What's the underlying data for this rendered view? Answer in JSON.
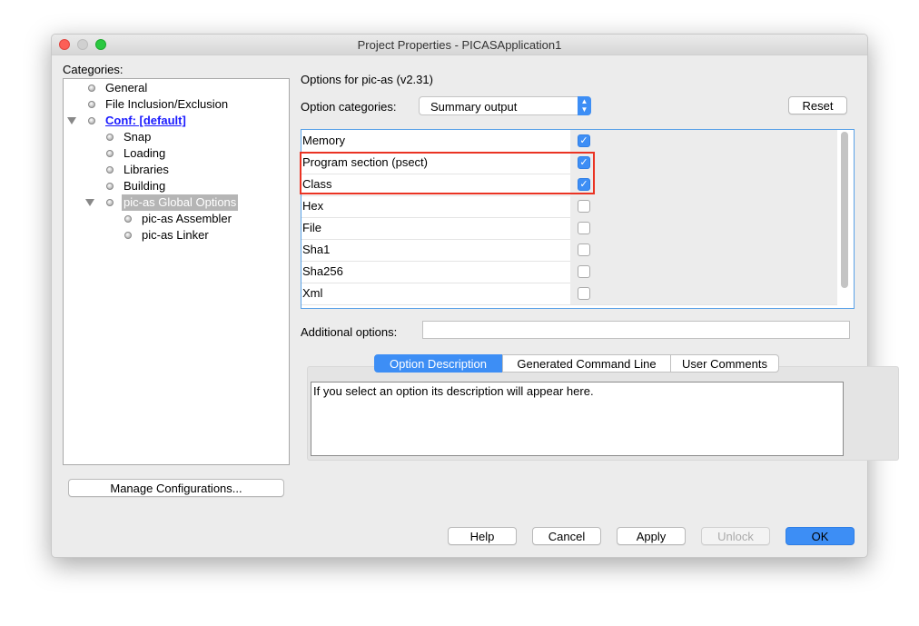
{
  "window": {
    "title": "Project Properties - PICASApplication1"
  },
  "categories": {
    "label": "Categories:",
    "items": [
      {
        "label": "General"
      },
      {
        "label": "File Inclusion/Exclusion"
      },
      {
        "label": "Conf: [default]",
        "expanded": true
      },
      {
        "label": "Snap"
      },
      {
        "label": "Loading"
      },
      {
        "label": "Libraries"
      },
      {
        "label": "Building"
      },
      {
        "label": "pic-as Global Options",
        "expanded": true,
        "selected": true
      },
      {
        "label": "pic-as Assembler"
      },
      {
        "label": "pic-as Linker"
      }
    ],
    "manage_button": "Manage Configurations..."
  },
  "options": {
    "heading": "Options for pic-as (v2.31)",
    "category_label": "Option categories:",
    "category_value": "Summary output",
    "reset_button": "Reset",
    "rows": [
      {
        "label": "Memory",
        "checked": true
      },
      {
        "label": "Program section (psect)",
        "checked": true
      },
      {
        "label": "Class",
        "checked": true
      },
      {
        "label": "Hex",
        "checked": false
      },
      {
        "label": "File",
        "checked": false
      },
      {
        "label": "Sha1",
        "checked": false
      },
      {
        "label": "Sha256",
        "checked": false
      },
      {
        "label": "Xml",
        "checked": false
      }
    ],
    "additional_label": "Additional options:",
    "additional_value": ""
  },
  "tabs": [
    {
      "label": "Option Description",
      "active": true
    },
    {
      "label": "Generated Command Line"
    },
    {
      "label": "User Comments"
    }
  ],
  "description": "If you select an option its description will appear here.",
  "buttons": {
    "help": "Help",
    "cancel": "Cancel",
    "apply": "Apply",
    "unlock": "Unlock",
    "ok": "OK"
  },
  "colors": {
    "accent": "#3d8ef5",
    "highlight_box": "#ea3323",
    "link": "#1a1aff"
  }
}
